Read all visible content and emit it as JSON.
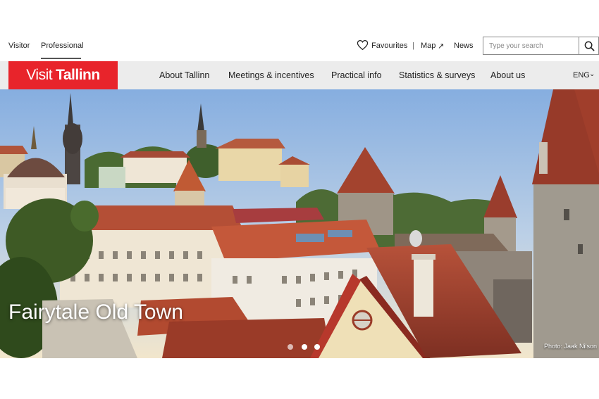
{
  "audience_tabs": {
    "visitor": "Visitor",
    "professional": "Professional",
    "active": "Professional"
  },
  "utility": {
    "favourites": "Favourites",
    "separator": "|",
    "map": "Map",
    "map_arrow": "↗",
    "news": "News"
  },
  "search": {
    "placeholder": "Type your search",
    "value": ""
  },
  "logo": {
    "part1": "Visit",
    "part2": "Tallinn",
    "color": "#e8242b"
  },
  "nav": {
    "items": [
      {
        "label": "About Tallinn"
      },
      {
        "label": "Meetings & incentives"
      },
      {
        "label": "Practical info"
      },
      {
        "label": "Statistics & surveys"
      },
      {
        "label": "About us"
      }
    ],
    "language": "ENG",
    "language_chevron": "⌄"
  },
  "hero": {
    "title": "Fairytale Old Town",
    "credit": "Photo: Jaak Nilson",
    "slides": 3,
    "active_slide": 2
  },
  "icons": {
    "favourites": "heart-icon",
    "search": "search-icon",
    "map": "external-arrow-icon",
    "language": "chevron-down-icon"
  }
}
